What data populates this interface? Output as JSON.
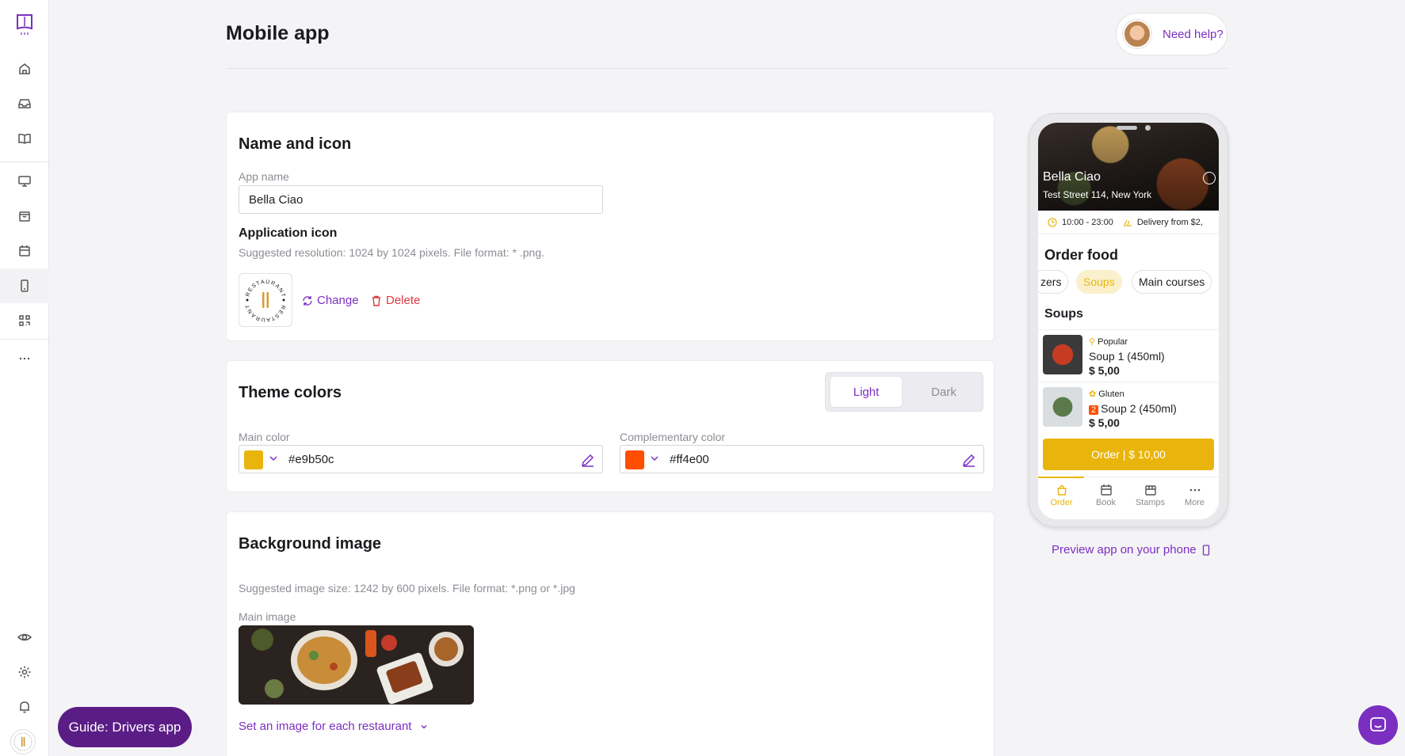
{
  "page": {
    "title": "Mobile app"
  },
  "help": {
    "label": "Need help?"
  },
  "name_icon": {
    "title": "Name and icon",
    "app_name_label": "App name",
    "app_name_value": "Bella Ciao",
    "app_icon_label": "Application icon",
    "app_icon_hint": "Suggested resolution: 1024 by 1024 pixels. File format: * .png.",
    "change_label": "Change",
    "delete_label": "Delete",
    "icon_text_top": "RESTAURANT",
    "icon_text_bottom": "RESTAURANT"
  },
  "theme": {
    "title": "Theme colors",
    "modes": [
      "Light",
      "Dark"
    ],
    "selected_mode": "Light",
    "main_color_label": "Main color",
    "main_color": "#e9b50c",
    "main_color_text": "#e9b50c",
    "comp_color_label": "Complementary color",
    "comp_color": "#ff4e00",
    "comp_color_text": "#ff4e00"
  },
  "background": {
    "title": "Background image",
    "hint": "Suggested image size: 1242 by 600 pixels. File format: *.png or *.jpg",
    "main_image_label": "Main image",
    "per_restaurant_label": "Set an image for each restaurant"
  },
  "preview": {
    "restaurant_name": "Bella Ciao",
    "address": "Test Street 114, New York",
    "hours": "10:00 - 23:00",
    "delivery": "Delivery from $2,",
    "order_food": "Order food",
    "categories": [
      "zers",
      "Soups",
      "Main courses"
    ],
    "selected_category": "Soups",
    "section_title": "Soups",
    "items": [
      {
        "tag": "Popular",
        "badge": "",
        "name": "Soup 1 (450ml)",
        "price": "$ 5,00"
      },
      {
        "tag": "Gluten",
        "badge": "2",
        "name": "Soup 2 (450ml)",
        "price": "$ 5,00"
      }
    ],
    "order_button": "Order | $ 10,00",
    "tabs": [
      "Order",
      "Book",
      "Stamps",
      "More"
    ],
    "active_tab": "Order",
    "preview_link": "Preview app on your phone"
  },
  "guide": {
    "label": "Guide: Drivers app"
  },
  "colors": {
    "accent": "#7b2fc1",
    "guide_bg": "#5a1d86",
    "delete": "#e0383e"
  },
  "sidebar_icons": [
    "logo-icon",
    "home-icon",
    "inbox-icon",
    "book-icon",
    "monitor-icon",
    "bag-icon",
    "calendar-icon",
    "mobile-icon",
    "qr-icon",
    "more-icon",
    "eye-icon",
    "settings-icon",
    "bell-icon"
  ]
}
